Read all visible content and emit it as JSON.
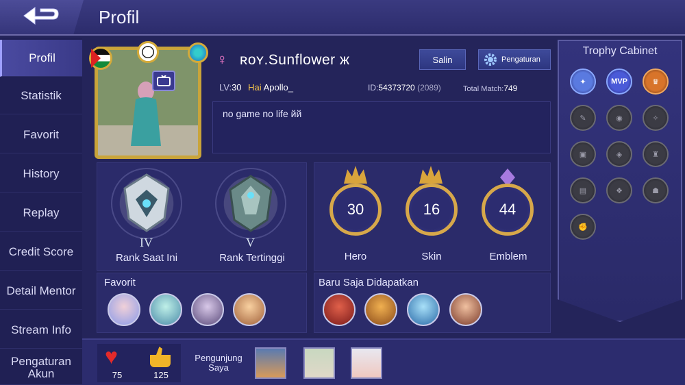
{
  "header": {
    "title": "Profil"
  },
  "sidebar": {
    "items": [
      {
        "label": "Profil"
      },
      {
        "label": "Statistik"
      },
      {
        "label": "Favorit"
      },
      {
        "label": "History"
      },
      {
        "label": "Replay"
      },
      {
        "label": "Credit Score"
      },
      {
        "label": "Detail Mentor"
      },
      {
        "label": "Stream Info"
      },
      {
        "label": "Pengaturan Akun"
      }
    ]
  },
  "profile": {
    "gender_symbol": "♀",
    "name": "ʀoʏ.Sunflower ж",
    "level_label": "LV:",
    "level": "30",
    "greeting": "Hai",
    "greeting_name": "Apollo_",
    "id_label": "ID:",
    "id": "54373720",
    "server": "(2089)",
    "total_match_label": "Total Match:",
    "total_match": "749",
    "bio": "no game no life йй"
  },
  "buttons": {
    "copy": "Salin",
    "settings": "Pengaturan"
  },
  "ranks": {
    "current": "Rank Saat Ini",
    "current_tier": "IV",
    "highest": "Rank Tertinggi",
    "highest_tier": "V"
  },
  "stats": [
    {
      "label": "Hero",
      "value": "30"
    },
    {
      "label": "Skin",
      "value": "16"
    },
    {
      "label": "Emblem",
      "value": "44"
    }
  ],
  "favorites": {
    "title": "Favorit"
  },
  "recent": {
    "title": "Baru Saja Didapatkan"
  },
  "trophy_cabinet": {
    "title": "Trophy Cabinet",
    "mvp": "MVP"
  },
  "footer": {
    "likes": "75",
    "thumbs": "125",
    "visitors_label": "Pengunjung Saya"
  }
}
